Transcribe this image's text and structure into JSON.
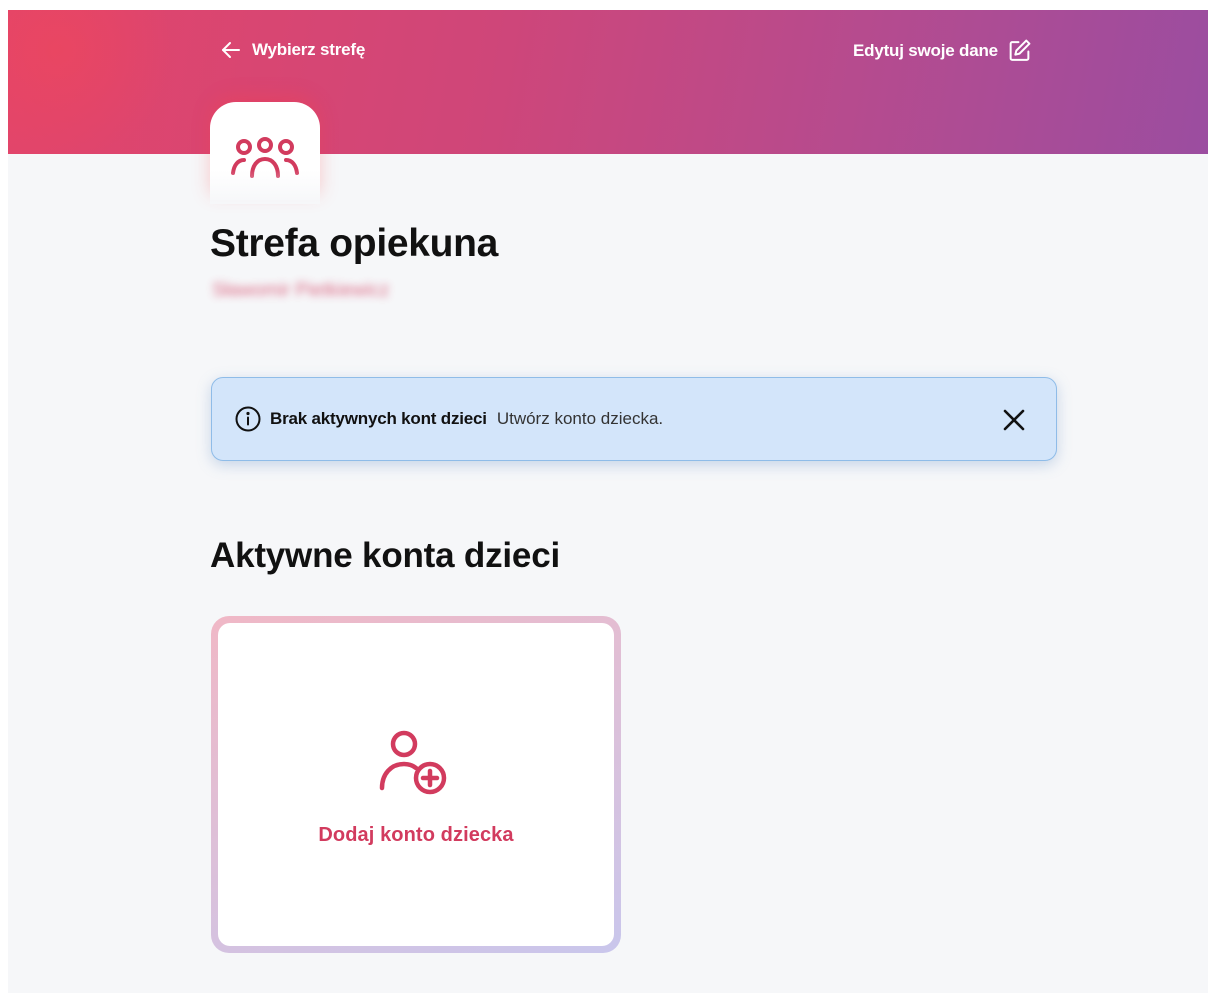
{
  "header": {
    "back_label": "Wybierz strefę",
    "edit_label": "Edytuj swoje dane"
  },
  "zone": {
    "title": "Strefa opiekuna",
    "user_name": "Sławomir Pietkiewicz"
  },
  "alert": {
    "title": "Brak aktywnych kont dzieci",
    "text": "Utwórz konto dziecka."
  },
  "children": {
    "section_title": "Aktywne konta dzieci",
    "add_label": "Dodaj konto dziecka"
  },
  "colors": {
    "accent": "#d23b5e",
    "header_start": "#e3456a",
    "header_end": "#9b4da0",
    "alert_bg": "#d3e5fa"
  },
  "icons": {
    "back": "arrow-left-icon",
    "edit": "edit-icon",
    "zone": "users-group-icon",
    "info": "info-icon",
    "close": "close-icon",
    "add_user": "user-plus-icon"
  }
}
